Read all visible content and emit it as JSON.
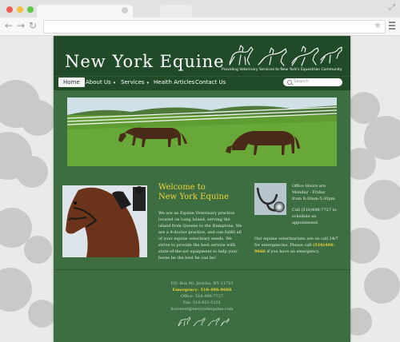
{
  "browser": {
    "url": "",
    "nav": {
      "back": "←",
      "forward": "→",
      "reload": "↻"
    },
    "icons": [
      "close-icon",
      "minimize-icon",
      "zoom-icon",
      "star-icon",
      "menu-icon"
    ]
  },
  "site": {
    "logo_text": "New York Equine",
    "tagline": "Providing Veterinary Services to New York's Equestrian Community",
    "colors": {
      "header": "#214a28",
      "page": "#3c6e42",
      "accent": "#f2d43a"
    }
  },
  "nav": {
    "items": [
      {
        "label": "Home",
        "active": true,
        "dropdown": false
      },
      {
        "label": "About Us",
        "active": false,
        "dropdown": true
      },
      {
        "label": "Services",
        "active": false,
        "dropdown": true
      },
      {
        "label": "Health Articles",
        "active": false,
        "dropdown": false
      },
      {
        "label": "Contact Us",
        "active": false,
        "dropdown": false
      }
    ],
    "caret": "▾",
    "search_placeholder": "Search"
  },
  "main": {
    "welcome_line1": "Welcome to",
    "welcome_line2": "New York Equine",
    "intro": "We are an Equine Veterinary practice located on Long Island, serving the island from Queens to the Hamptons. We are a 4-doctor practice, and can fulfill all of your equine veterinary needs. We strive to provide the best service with state-of-the-art equipment to help your horse be the best he can be!"
  },
  "sidebar": {
    "hours_line1": "Office Hours are",
    "hours_line2": "Monday - Friday",
    "hours_line3": "from 8:30am-5:30pm.",
    "call_pre": "Call (516)496-7727 to",
    "call_post": "schedule an appointment.",
    "emergency_pre": "Our equine veterinarians are on call 24/7 for emergencies. Please call",
    "emergency_phone": "(516)496-9666",
    "emergency_post": "if you have an emergency."
  },
  "footer": {
    "address": "P.O. Box 90, Jericho, NY 11753",
    "emergency": "Emergency- 516-496-9666",
    "office": "Office- 516-496-7727",
    "fax": "Fax- 516-621-5151",
    "email": "horsevet@newyorkequine.com"
  }
}
